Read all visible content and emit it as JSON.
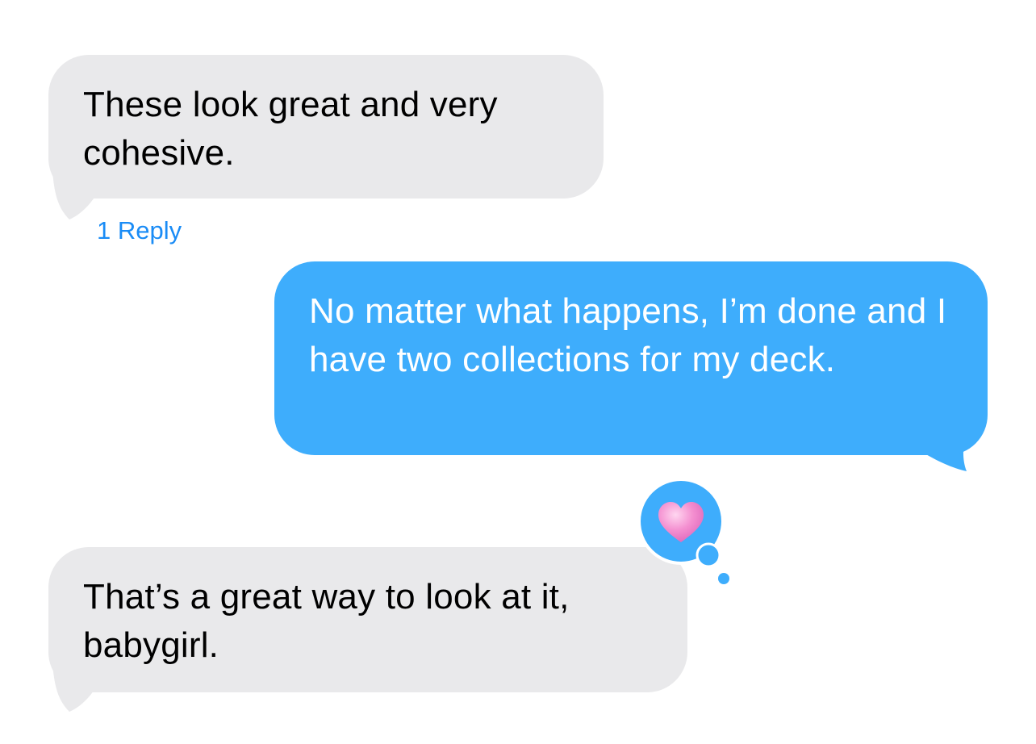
{
  "messages": [
    {
      "direction": "received",
      "text": "These look great and very cohesive."
    },
    {
      "direction": "sent",
      "text": "No matter what happens, I’m done and I have two collections for my deck."
    },
    {
      "direction": "received",
      "text": "That’s a great way to look at it, babygirl."
    }
  ],
  "thread": {
    "reply_label": "1 Reply"
  },
  "reaction": {
    "icon": "pink-heart-icon",
    "on_message": 2
  },
  "colors": {
    "received_bubble": "#e9e9eb",
    "sent_bubble": "#3eadfc",
    "reply_link": "#1a8cf6",
    "heart": "#f48fd0"
  }
}
